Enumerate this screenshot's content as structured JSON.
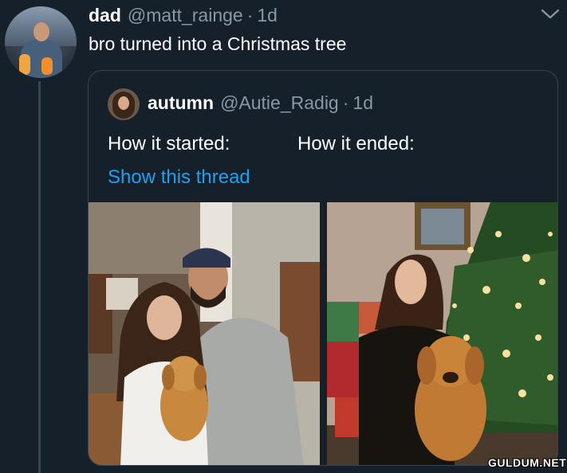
{
  "tweet": {
    "author_name": "dad",
    "author_handle": "@matt_rainge",
    "separator": "·",
    "time": "1d",
    "text": "bro turned into a Christmas tree",
    "menu_icon": "chevron-down-icon"
  },
  "quoted_tweet": {
    "author_name": "autumn",
    "author_handle": "@Autie_Radig",
    "separator": "·",
    "time": "1d",
    "text_left": "How it started:",
    "text_right": "How it ended:",
    "show_thread_label": "Show this thread",
    "photos": [
      {
        "description_icon": "photo-couple-with-puppy"
      },
      {
        "description_icon": "photo-woman-with-dog-by-christmas-tree"
      }
    ]
  },
  "watermark": "GULDUM.NET",
  "colors": {
    "background": "#15202b",
    "border": "#38444d",
    "secondary_text": "#8899a6",
    "link": "#1da1f2"
  }
}
